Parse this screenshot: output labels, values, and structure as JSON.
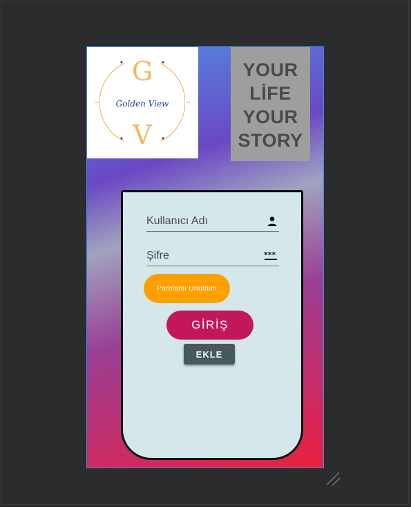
{
  "logo": {
    "top_letter": "G",
    "script_text": "Golden View",
    "bottom_letter": "V"
  },
  "slogan": {
    "lines": [
      "YOUR",
      "LİFE",
      "YOUR",
      "STORY"
    ]
  },
  "login": {
    "username_placeholder": "Kullanıcı Adı",
    "password_placeholder": "Şifre",
    "forgot_label": "Parolamı Unuttum",
    "login_label": "GİRİŞ",
    "add_label": "EKLE"
  },
  "icons": {
    "username": "person-icon",
    "password": "password-dots-icon",
    "resize": "resize-handle-icon"
  },
  "colors": {
    "forgot_button": "#ffa000",
    "login_button": "#c2185b",
    "add_button": "#455a5c",
    "card_background": "#d4e7ea",
    "slogan_background": "#9e9e9e"
  }
}
